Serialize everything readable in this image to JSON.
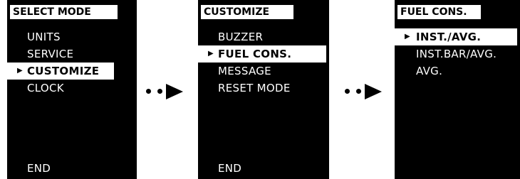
{
  "colors": {
    "background": "#ffffff",
    "panel": "#000000",
    "highlight": "#ffffff"
  },
  "panels": [
    {
      "title": "SELECT MODE",
      "items": [
        "UNITS",
        "SERVICE",
        "CUSTOMIZE",
        "CLOCK"
      ],
      "selected": "CUSTOMIZE",
      "footer": "END"
    },
    {
      "title": "CUSTOMIZE",
      "items": [
        "BUZZER",
        "FUEL CONS.",
        "MESSAGE",
        "RESET MODE"
      ],
      "selected": "FUEL CONS.",
      "footer": "END"
    },
    {
      "title": "FUEL CONS.",
      "items": [
        "INST./AVG.",
        "INST.BAR/AVG.",
        "AVG."
      ],
      "selected": "INST./AVG."
    }
  ],
  "icons": {
    "selection": "right-triangle-icon",
    "connector": "dot-dot-arrow-icon"
  }
}
